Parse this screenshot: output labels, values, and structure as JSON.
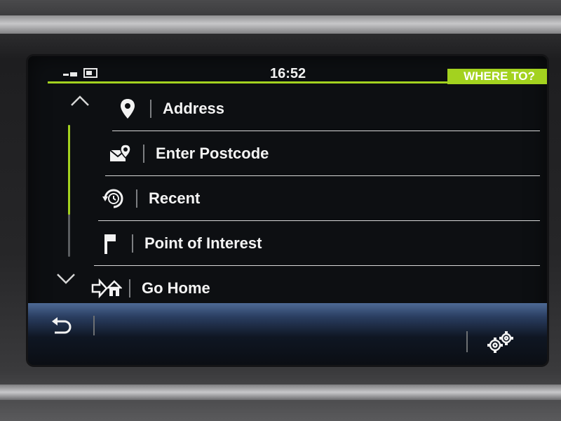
{
  "status_bar": {
    "time": "16:52",
    "mode_label": "WHERE TO?",
    "accent_color": "#a3d21f"
  },
  "navigation": {
    "scroll_up_icon": "chevron-up-icon",
    "scroll_down_icon": "chevron-down-icon",
    "scroll_position": 0.0
  },
  "menu": {
    "items": [
      {
        "label": "Address",
        "icon": "location-pin-icon"
      },
      {
        "label": "Enter Postcode",
        "icon": "postcode-envelope-pin-icon"
      },
      {
        "label": "Recent",
        "icon": "recent-clock-icon"
      },
      {
        "label": "Point of Interest",
        "icon": "flag-icon"
      },
      {
        "label": "Go Home",
        "icon": "go-home-icon"
      }
    ]
  },
  "bottom_bar": {
    "back_icon": "back-arrow-icon",
    "settings_icon": "settings-gears-icon"
  }
}
